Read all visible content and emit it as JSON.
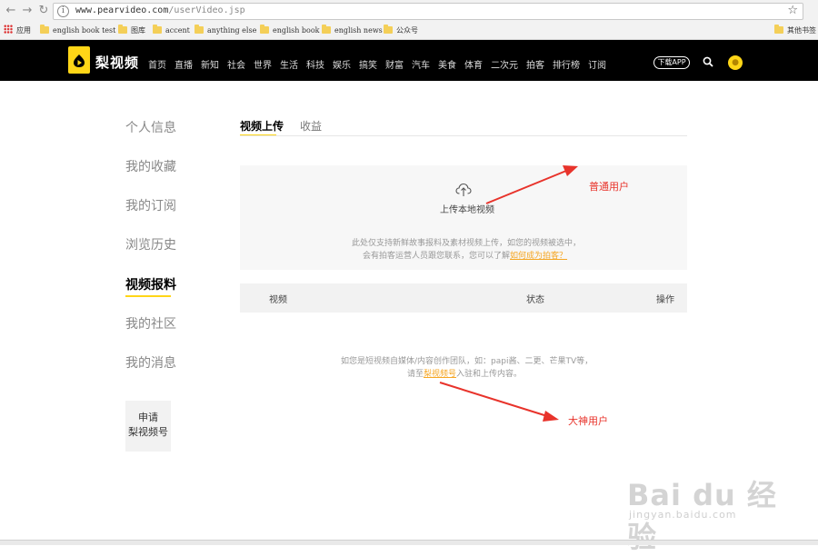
{
  "browser": {
    "url_host": "www.pearvideo.com",
    "url_path": "/userVideo.jsp",
    "bookmarks": [
      {
        "label": "应用",
        "type": "apps"
      },
      {
        "label": "english book test",
        "type": "folder"
      },
      {
        "label": "图库",
        "type": "folder"
      },
      {
        "label": "accent",
        "type": "folder"
      },
      {
        "label": "anything else",
        "type": "folder"
      },
      {
        "label": "english book",
        "type": "folder"
      },
      {
        "label": "english news",
        "type": "folder"
      },
      {
        "label": "公众号",
        "type": "folder"
      },
      {
        "label": "其他书签",
        "type": "folder"
      }
    ]
  },
  "site": {
    "logo_text": "梨视频",
    "nav": [
      "首页",
      "直播",
      "新知",
      "社会",
      "世界",
      "生活",
      "科技",
      "娱乐",
      "搞笑",
      "财富",
      "汽车",
      "美食",
      "体育",
      "二次元",
      "拍客",
      "排行榜",
      "订阅"
    ],
    "app_button": "下载APP",
    "accent_color": "#ffd617"
  },
  "sidebar": {
    "items": [
      "个人信息",
      "我的收藏",
      "我的订阅",
      "浏览历史",
      "视频报料",
      "我的社区",
      "我的消息"
    ],
    "active": "视频报料",
    "apply_line1": "申请",
    "apply_line2": "梨视频号"
  },
  "main": {
    "tabs": [
      "视频上传",
      "收益"
    ],
    "upload_label": "上传本地视频",
    "note_line1": "此处仅支持新鲜故事报料及素材视频上传，如您的视频被选中，",
    "note_line2_prefix": "会有拍客运营人员跟您联系，您可以了解",
    "note_line2_link": "如何成为拍客？",
    "table_headers": [
      "视频",
      "状态",
      "操作"
    ],
    "bottom_line1": "如您是短视频自媒体/内容创作团队，如：papi酱、二更、芒果TV等，",
    "bottom_line2_prefix": "请至",
    "bottom_line2_link": "梨视频号",
    "bottom_line2_suffix": "入驻和上传内容。"
  },
  "annotations": {
    "label_normal": "普通用户",
    "label_master": "大神用户",
    "color": "#e8332b"
  },
  "watermark": {
    "main": "Bai du 经验",
    "sub": "jingyan.baidu.com"
  }
}
